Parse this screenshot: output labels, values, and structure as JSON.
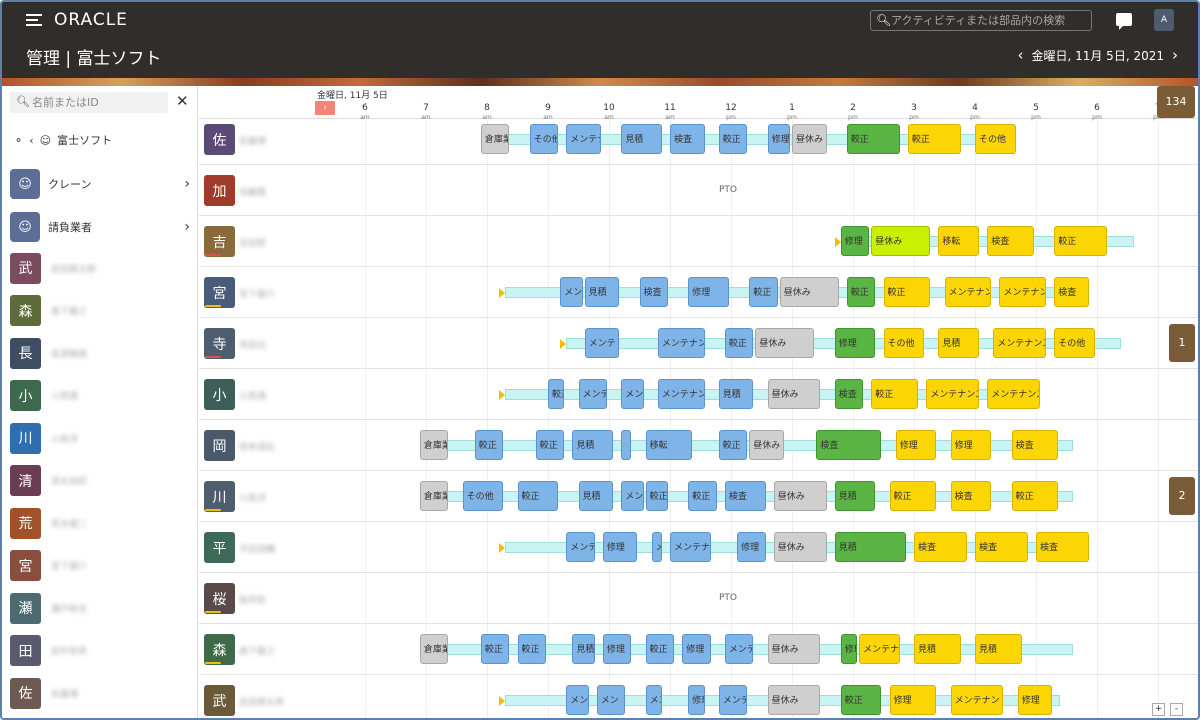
{
  "header": {
    "logo": "ORACLE",
    "title": "管理 | 富士ソフト",
    "search_placeholder": "アクティビティまたは部品内の検索",
    "avatar": "A",
    "date": "金曜日, 11月 5日, 2021"
  },
  "sidebar": {
    "search_placeholder": "名前またはID",
    "crumb": "富士ソフト",
    "groups": [
      {
        "label": "クレーン"
      },
      {
        "label": "請負業者"
      }
    ],
    "people": [
      {
        "kanji": "武",
        "name": "武田健太郎",
        "color": "#7b4b5e"
      },
      {
        "kanji": "森",
        "name": "森下義之",
        "color": "#5d6a3a"
      },
      {
        "kanji": "長",
        "name": "長澤雅樹",
        "color": "#3e4d63"
      },
      {
        "kanji": "小",
        "name": "小西満",
        "color": "#3d6a4e"
      },
      {
        "kanji": "川",
        "name": "川島淳",
        "color": "#2f6fb0"
      },
      {
        "kanji": "清",
        "name": "清水由紀",
        "color": "#6a3d55"
      },
      {
        "kanji": "荒",
        "name": "荒木健二",
        "color": "#a0522d"
      },
      {
        "kanji": "宮",
        "name": "宮下雄介",
        "color": "#8a4e3e"
      },
      {
        "kanji": "瀬",
        "name": "瀬戸和也",
        "color": "#4d6a70"
      },
      {
        "kanji": "田",
        "name": "田中和幸",
        "color": "#5a5a6e"
      },
      {
        "kanji": "佐",
        "name": "佐藤博",
        "color": "#6e5a52"
      }
    ]
  },
  "timeline": {
    "date_label": "金曜日, 11月 5日",
    "now_button": "›",
    "total_count": "134",
    "ticks": [
      {
        "h": "6",
        "p": "am"
      },
      {
        "h": "7",
        "p": "am"
      },
      {
        "h": "8",
        "p": "am"
      },
      {
        "h": "9",
        "p": "am"
      },
      {
        "h": "10",
        "p": "am"
      },
      {
        "h": "11",
        "p": "am"
      },
      {
        "h": "12",
        "p": "pm"
      },
      {
        "h": "1",
        "p": "pm"
      },
      {
        "h": "2",
        "p": "pm"
      },
      {
        "h": "3",
        "p": "pm"
      },
      {
        "h": "4",
        "p": "pm"
      },
      {
        "h": "5",
        "p": "pm"
      },
      {
        "h": "6",
        "p": "pm"
      },
      {
        "h": "7",
        "p": "pm"
      }
    ],
    "rows": [
      {
        "kanji": "佐",
        "name": "佐藤博",
        "color": "#5a4a78",
        "status_color": "",
        "track": [
          8.0,
          16.6
        ],
        "blocks": [
          {
            "l": "倉庫業",
            "s": 7.9,
            "e": 8.4,
            "c": "gray"
          },
          {
            "l": "その他",
            "s": 8.7,
            "e": 9.2,
            "c": "blue"
          },
          {
            "l": "メンテナ",
            "s": 9.3,
            "e": 9.9,
            "c": "blue"
          },
          {
            "l": "見積",
            "s": 10.2,
            "e": 10.9,
            "c": "blue"
          },
          {
            "l": "検査",
            "s": 11.0,
            "e": 11.6,
            "c": "blue"
          },
          {
            "l": "較正",
            "s": 11.8,
            "e": 12.3,
            "c": "blue"
          },
          {
            "l": "修理",
            "s": 12.6,
            "e": 13.0,
            "c": "blue"
          },
          {
            "l": "昼休み",
            "s": 13.0,
            "e": 13.6,
            "c": "gray"
          },
          {
            "l": "較正",
            "s": 13.9,
            "e": 14.8,
            "c": "green"
          },
          {
            "l": "較正",
            "s": 14.9,
            "e": 15.8,
            "c": "yellow"
          },
          {
            "l": "その他",
            "s": 16.0,
            "e": 16.7,
            "c": "yellow"
          }
        ]
      },
      {
        "kanji": "加",
        "name": "加藤隆",
        "color": "#a03a2a",
        "status_color": "",
        "pto": "PTO",
        "track": null,
        "blocks": []
      },
      {
        "kanji": "吉",
        "name": "吉田修",
        "color": "#8a6a3a",
        "status_color": "#e05050",
        "track": [
          13.8,
          18.6
        ],
        "blocks": [
          {
            "l": "修理",
            "s": 13.8,
            "e": 14.3,
            "c": "green"
          },
          {
            "l": "昼休み",
            "s": 14.3,
            "e": 15.3,
            "c": "lime"
          },
          {
            "l": "移転",
            "s": 15.4,
            "e": 16.1,
            "c": "yellow"
          },
          {
            "l": "検査",
            "s": 16.2,
            "e": 17.0,
            "c": "yellow"
          },
          {
            "l": "較正",
            "s": 17.3,
            "e": 18.2,
            "c": "yellow"
          }
        ]
      },
      {
        "kanji": "宮",
        "name": "宮下雄介",
        "color": "#4a5a7a",
        "status_color": "#f0c000",
        "track": [
          8.3,
          17.6
        ],
        "blocks": [
          {
            "l": "メンテ",
            "s": 9.2,
            "e": 9.6,
            "c": "blue"
          },
          {
            "l": "見積",
            "s": 9.6,
            "e": 10.2,
            "c": "blue"
          },
          {
            "l": "検査",
            "s": 10.5,
            "e": 11.0,
            "c": "blue"
          },
          {
            "l": "修理",
            "s": 11.3,
            "e": 12.0,
            "c": "blue"
          },
          {
            "l": "較正",
            "s": 12.3,
            "e": 12.8,
            "c": "blue"
          },
          {
            "l": "昼休み",
            "s": 12.8,
            "e": 13.8,
            "c": "gray"
          },
          {
            "l": "較正",
            "s": 13.9,
            "e": 14.4,
            "c": "green"
          },
          {
            "l": "較正",
            "s": 14.5,
            "e": 15.3,
            "c": "yellow"
          },
          {
            "l": "メンテナン",
            "s": 15.5,
            "e": 16.3,
            "c": "yellow"
          },
          {
            "l": "メンテナン",
            "s": 16.4,
            "e": 17.2,
            "c": "yellow"
          },
          {
            "l": "検査",
            "s": 17.3,
            "e": 17.9,
            "c": "yellow"
          }
        ]
      },
      {
        "kanji": "寺",
        "name": "寺田光",
        "color": "#4e5e6e",
        "status_color": "#e05050",
        "track": [
          9.3,
          18.4
        ],
        "blocks": [
          {
            "l": "メンテ",
            "s": 9.6,
            "e": 10.2,
            "c": "blue"
          },
          {
            "l": "メンテナン",
            "s": 10.8,
            "e": 11.6,
            "c": "blue"
          },
          {
            "l": "較正",
            "s": 11.9,
            "e": 12.4,
            "c": "blue"
          },
          {
            "l": "昼休み",
            "s": 12.4,
            "e": 13.4,
            "c": "gray"
          },
          {
            "l": "修理",
            "s": 13.7,
            "e": 14.4,
            "c": "green"
          },
          {
            "l": "その他",
            "s": 14.5,
            "e": 15.2,
            "c": "yellow"
          },
          {
            "l": "見積",
            "s": 15.4,
            "e": 16.1,
            "c": "yellow"
          },
          {
            "l": "メンテナンス",
            "s": 16.3,
            "e": 17.2,
            "c": "yellow"
          },
          {
            "l": "その他",
            "s": 17.3,
            "e": 18.0,
            "c": "yellow"
          }
        ]
      },
      {
        "kanji": "小",
        "name": "小西満",
        "color": "#3e5e5a",
        "status_color": "",
        "track": [
          8.3,
          16.8
        ],
        "blocks": [
          {
            "l": "較正",
            "s": 9.0,
            "e": 9.3,
            "c": "blue"
          },
          {
            "l": "メンテ",
            "s": 9.5,
            "e": 10.0,
            "c": "blue"
          },
          {
            "l": "メン",
            "s": 10.2,
            "e": 10.6,
            "c": "blue"
          },
          {
            "l": "メンテナン",
            "s": 10.8,
            "e": 11.6,
            "c": "blue"
          },
          {
            "l": "見積",
            "s": 11.8,
            "e": 12.4,
            "c": "blue"
          },
          {
            "l": "昼休み",
            "s": 12.6,
            "e": 13.5,
            "c": "gray"
          },
          {
            "l": "検査",
            "s": 13.7,
            "e": 14.2,
            "c": "green"
          },
          {
            "l": "較正",
            "s": 14.3,
            "e": 15.1,
            "c": "yellow"
          },
          {
            "l": "メンテナンス",
            "s": 15.2,
            "e": 16.1,
            "c": "yellow"
          },
          {
            "l": "メンテナンス",
            "s": 16.2,
            "e": 17.1,
            "c": "yellow"
          }
        ]
      },
      {
        "kanji": "岡",
        "name": "岡本靖弘",
        "color": "#4a5a6a",
        "status_color": "",
        "track": [
          7.0,
          17.6
        ],
        "blocks": [
          {
            "l": "倉庫業",
            "s": 6.9,
            "e": 7.4,
            "c": "gray"
          },
          {
            "l": "較正",
            "s": 7.8,
            "e": 8.3,
            "c": "blue"
          },
          {
            "l": "較正",
            "s": 8.8,
            "e": 9.3,
            "c": "blue"
          },
          {
            "l": "見積",
            "s": 9.4,
            "e": 10.1,
            "c": "blue"
          },
          {
            "l": "",
            "s": 10.2,
            "e": 10.4,
            "c": "blue"
          },
          {
            "l": "移転",
            "s": 10.6,
            "e": 11.4,
            "c": "blue"
          },
          {
            "l": "較正",
            "s": 11.8,
            "e": 12.3,
            "c": "blue"
          },
          {
            "l": "昼休み",
            "s": 12.3,
            "e": 12.9,
            "c": "gray"
          },
          {
            "l": "検査",
            "s": 13.4,
            "e": 14.5,
            "c": "green"
          },
          {
            "l": "修理",
            "s": 14.7,
            "e": 15.4,
            "c": "yellow"
          },
          {
            "l": "修理",
            "s": 15.6,
            "e": 16.3,
            "c": "yellow"
          },
          {
            "l": "検査",
            "s": 16.6,
            "e": 17.4,
            "c": "yellow"
          }
        ]
      },
      {
        "kanji": "川",
        "name": "川島淳",
        "color": "#4e5e6e",
        "status_color": "#f0c000",
        "track": [
          7.0,
          17.6
        ],
        "blocks": [
          {
            "l": "倉庫業",
            "s": 6.9,
            "e": 7.4,
            "c": "gray"
          },
          {
            "l": "その他",
            "s": 7.6,
            "e": 8.3,
            "c": "blue"
          },
          {
            "l": "較正",
            "s": 8.5,
            "e": 9.2,
            "c": "blue"
          },
          {
            "l": "見積",
            "s": 9.5,
            "e": 10.1,
            "c": "blue"
          },
          {
            "l": "メン",
            "s": 10.2,
            "e": 10.6,
            "c": "blue"
          },
          {
            "l": "較正",
            "s": 10.6,
            "e": 11.0,
            "c": "blue"
          },
          {
            "l": "較正",
            "s": 11.3,
            "e": 11.8,
            "c": "blue"
          },
          {
            "l": "検査",
            "s": 11.9,
            "e": 12.6,
            "c": "blue"
          },
          {
            "l": "昼休み",
            "s": 12.7,
            "e": 13.6,
            "c": "gray"
          },
          {
            "l": "見積",
            "s": 13.7,
            "e": 14.4,
            "c": "green"
          },
          {
            "l": "較正",
            "s": 14.6,
            "e": 15.4,
            "c": "yellow"
          },
          {
            "l": "検査",
            "s": 15.6,
            "e": 16.3,
            "c": "yellow"
          },
          {
            "l": "較正",
            "s": 16.6,
            "e": 17.4,
            "c": "yellow"
          }
        ]
      },
      {
        "kanji": "平",
        "name": "平田浩輔",
        "color": "#3e6a5a",
        "status_color": "",
        "track": [
          8.3,
          17.6
        ],
        "blocks": [
          {
            "l": "メンテ",
            "s": 9.3,
            "e": 9.8,
            "c": "blue"
          },
          {
            "l": "修理",
            "s": 9.9,
            "e": 10.5,
            "c": "blue"
          },
          {
            "l": "メ",
            "s": 10.7,
            "e": 10.9,
            "c": "blue"
          },
          {
            "l": "メンテナン",
            "s": 11.0,
            "e": 11.7,
            "c": "blue"
          },
          {
            "l": "修理",
            "s": 12.1,
            "e": 12.6,
            "c": "blue"
          },
          {
            "l": "昼休み",
            "s": 12.7,
            "e": 13.6,
            "c": "gray"
          },
          {
            "l": "見積",
            "s": 13.7,
            "e": 14.9,
            "c": "green"
          },
          {
            "l": "検査",
            "s": 15.0,
            "e": 15.9,
            "c": "yellow"
          },
          {
            "l": "検査",
            "s": 16.0,
            "e": 16.9,
            "c": "yellow"
          },
          {
            "l": "検査",
            "s": 17.0,
            "e": 17.9,
            "c": "yellow"
          }
        ]
      },
      {
        "kanji": "桜",
        "name": "桜井智",
        "color": "#5a4a4a",
        "status_color": "#f0c000",
        "pto": "PTO",
        "track": null,
        "blocks": []
      },
      {
        "kanji": "森",
        "name": "森下義之",
        "color": "#3e6a4a",
        "status_color": "#f0c000",
        "track": [
          7.0,
          17.6
        ],
        "blocks": [
          {
            "l": "倉庫業",
            "s": 6.9,
            "e": 7.4,
            "c": "gray"
          },
          {
            "l": "較正",
            "s": 7.9,
            "e": 8.4,
            "c": "blue"
          },
          {
            "l": "較正",
            "s": 8.5,
            "e": 9.0,
            "c": "blue"
          },
          {
            "l": "見積",
            "s": 9.4,
            "e": 9.8,
            "c": "blue"
          },
          {
            "l": "修理",
            "s": 9.9,
            "e": 10.4,
            "c": "blue"
          },
          {
            "l": "較正",
            "s": 10.6,
            "e": 11.1,
            "c": "blue"
          },
          {
            "l": "修理",
            "s": 11.2,
            "e": 11.7,
            "c": "blue"
          },
          {
            "l": "メンテナ",
            "s": 11.9,
            "e": 12.4,
            "c": "blue"
          },
          {
            "l": "昼休み",
            "s": 12.6,
            "e": 13.5,
            "c": "gray"
          },
          {
            "l": "修理",
            "s": 13.8,
            "e": 14.1,
            "c": "green"
          },
          {
            "l": "メンテナン",
            "s": 14.1,
            "e": 14.8,
            "c": "yellow"
          },
          {
            "l": "見積",
            "s": 15.0,
            "e": 15.8,
            "c": "yellow"
          },
          {
            "l": "見積",
            "s": 16.0,
            "e": 16.8,
            "c": "yellow"
          }
        ]
      },
      {
        "kanji": "武",
        "name": "武田健太郎",
        "color": "#6a5a3a",
        "status_color": "",
        "track": [
          8.3,
          17.4
        ],
        "blocks": [
          {
            "l": "メン",
            "s": 9.3,
            "e": 9.7,
            "c": "blue"
          },
          {
            "l": "メン",
            "s": 9.8,
            "e": 10.3,
            "c": "blue"
          },
          {
            "l": "メン",
            "s": 10.6,
            "e": 10.9,
            "c": "blue"
          },
          {
            "l": "修理",
            "s": 11.3,
            "e": 11.6,
            "c": "blue"
          },
          {
            "l": "メンテナン",
            "s": 11.8,
            "e": 12.3,
            "c": "blue"
          },
          {
            "l": "昼休み",
            "s": 12.6,
            "e": 13.5,
            "c": "gray"
          },
          {
            "l": "較正",
            "s": 13.8,
            "e": 14.5,
            "c": "green"
          },
          {
            "l": "修理",
            "s": 14.6,
            "e": 15.4,
            "c": "yellow"
          },
          {
            "l": "メンテナン",
            "s": 15.6,
            "e": 16.5,
            "c": "yellow"
          },
          {
            "l": "修理",
            "s": 16.7,
            "e": 17.3,
            "c": "yellow"
          }
        ]
      }
    ],
    "side_tags": [
      {
        "label": "1",
        "row": 4
      },
      {
        "label": "2",
        "row": 7
      }
    ],
    "zoom_in": "+",
    "zoom_out": "-"
  }
}
